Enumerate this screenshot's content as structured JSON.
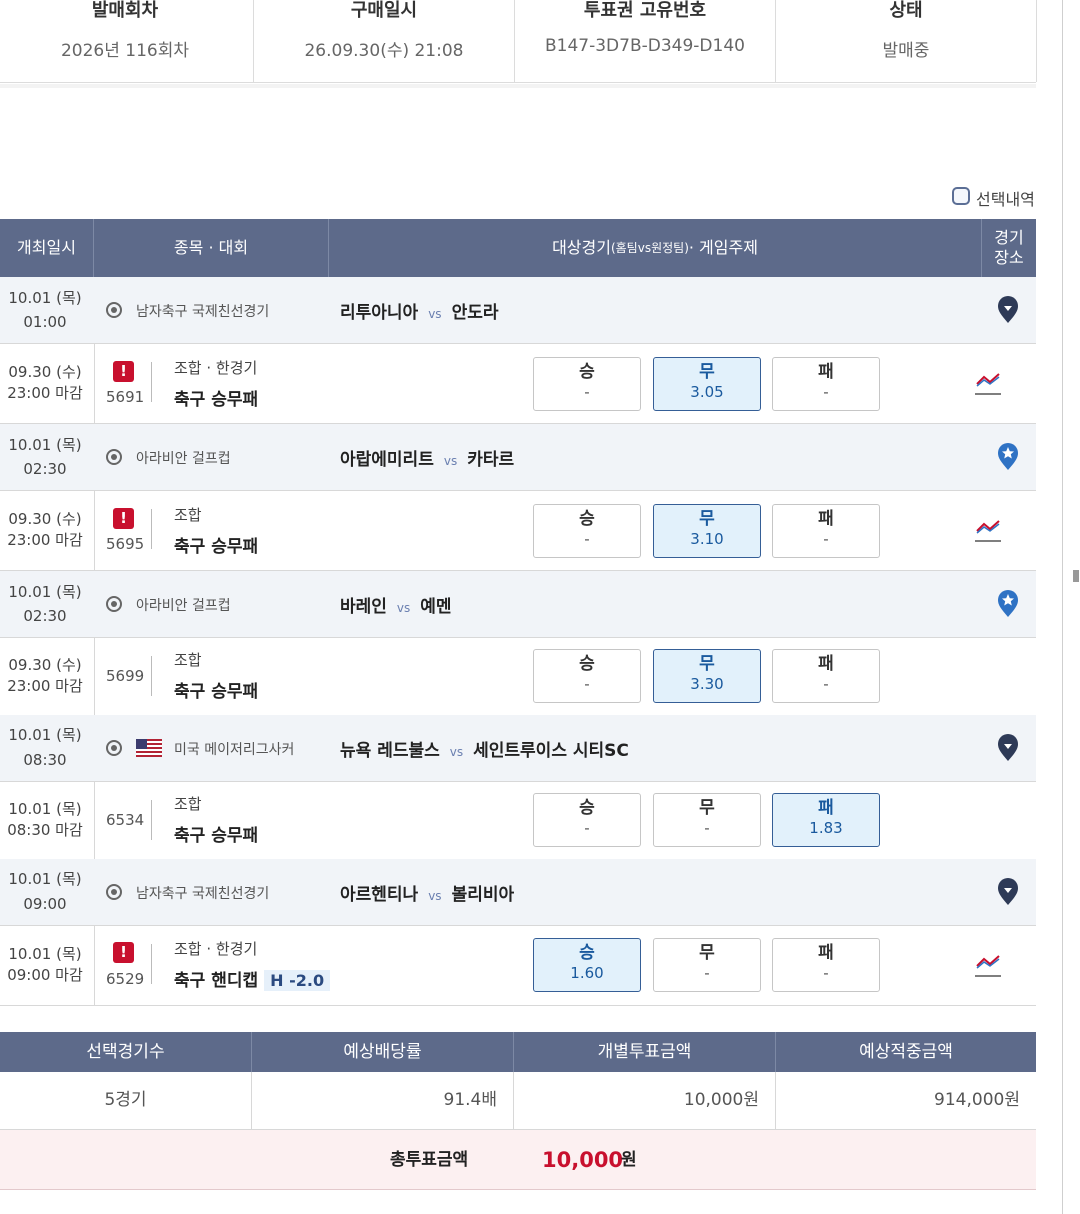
{
  "ticket_info": {
    "headers": [
      "발매회차",
      "구매일시",
      "투표권 고유번호",
      "상태"
    ],
    "values": [
      "2026년 116회차",
      "26.09.30(수) 21:08",
      "B147-3D7B-D349-D140",
      "발매중"
    ]
  },
  "selection_toggle_label": "선택내역",
  "table_headers": {
    "date": "개최일시",
    "sport": "종목 · 대회",
    "match_main": "대상경기",
    "match_small": "(홈팀vs원정팀)",
    "match_tail": " · 게임주제",
    "venue_line1": "경기",
    "venue_line2": "장소"
  },
  "vs_label": "vs",
  "matches": [
    {
      "date": "10.01 (목)",
      "time": "01:00",
      "league": "남자축구 국제친선경기",
      "home": "리투아니아",
      "away": "안도라",
      "deadline_date": "09.30 (수)",
      "deadline_time": "23:00 마감",
      "game_no": "5691",
      "game_type": "조합 · 한경기",
      "game_name": "축구 승무패",
      "handicap": "",
      "odds": [
        {
          "label": "승",
          "value": "-"
        },
        {
          "label": "무",
          "value": "3.05"
        },
        {
          "label": "패",
          "value": "-"
        }
      ],
      "selected": 1
    },
    {
      "date": "10.01 (목)",
      "time": "02:30",
      "league": "아라비안 걸프컵",
      "home": "아랍에미리트",
      "away": "카타르",
      "deadline_date": "09.30 (수)",
      "deadline_time": "23:00 마감",
      "game_no": "5695",
      "game_type": "조합",
      "game_name": "축구 승무패",
      "handicap": "",
      "odds": [
        {
          "label": "승",
          "value": "-"
        },
        {
          "label": "무",
          "value": "3.10"
        },
        {
          "label": "패",
          "value": "-"
        }
      ],
      "selected": 1
    },
    {
      "date": "10.01 (목)",
      "time": "02:30",
      "league": "아라비안 걸프컵",
      "home": "바레인",
      "away": "예멘",
      "deadline_date": "09.30 (수)",
      "deadline_time": "23:00 마감",
      "game_no": "5699",
      "game_type": "조합",
      "game_name": "축구 승무패",
      "handicap": "",
      "odds": [
        {
          "label": "승",
          "value": "-"
        },
        {
          "label": "무",
          "value": "3.30"
        },
        {
          "label": "패",
          "value": "-"
        }
      ],
      "selected": 1
    },
    {
      "date": "10.01 (목)",
      "time": "08:30",
      "league": "미국 메이저리그사커",
      "home": "뉴욕 레드불스",
      "away": "세인트루이스 시티SC",
      "deadline_date": "10.01 (목)",
      "deadline_time": "08:30 마감",
      "game_no": "6534",
      "game_type": "조합",
      "game_name": "축구 승무패",
      "handicap": "",
      "odds": [
        {
          "label": "승",
          "value": "-"
        },
        {
          "label": "무",
          "value": "-"
        },
        {
          "label": "패",
          "value": "1.83"
        }
      ],
      "selected": 2
    },
    {
      "date": "10.01 (목)",
      "time": "09:00",
      "league": "남자축구 국제친선경기",
      "home": "아르헨티나",
      "away": "볼리비아",
      "deadline_date": "10.01 (목)",
      "deadline_time": "09:00 마감",
      "game_no": "6529",
      "game_type": "조합 · 한경기",
      "game_name": "축구 핸디캡",
      "handicap": "H -2.0",
      "odds": [
        {
          "label": "승",
          "value": "1.60"
        },
        {
          "label": "무",
          "value": "-"
        },
        {
          "label": "패",
          "value": "-"
        }
      ],
      "selected": 0
    }
  ],
  "summary": {
    "headers": [
      "선택경기수",
      "예상배당률",
      "개별투표금액",
      "예상적중금액"
    ],
    "values": [
      "5경기",
      "91.4배",
      "10,000원",
      "914,000원"
    ],
    "total_label": "총투표금액",
    "total_value": "10,000",
    "total_unit": "원"
  },
  "colors": {
    "header_bg": "#5d6a8a",
    "accent_red": "#c8102e",
    "selected_bg": "#e2f1fb",
    "game_row_bg": "#f1f4f8",
    "pin_dark": "#2e3a57",
    "pin_blue": "#2f72c4"
  }
}
